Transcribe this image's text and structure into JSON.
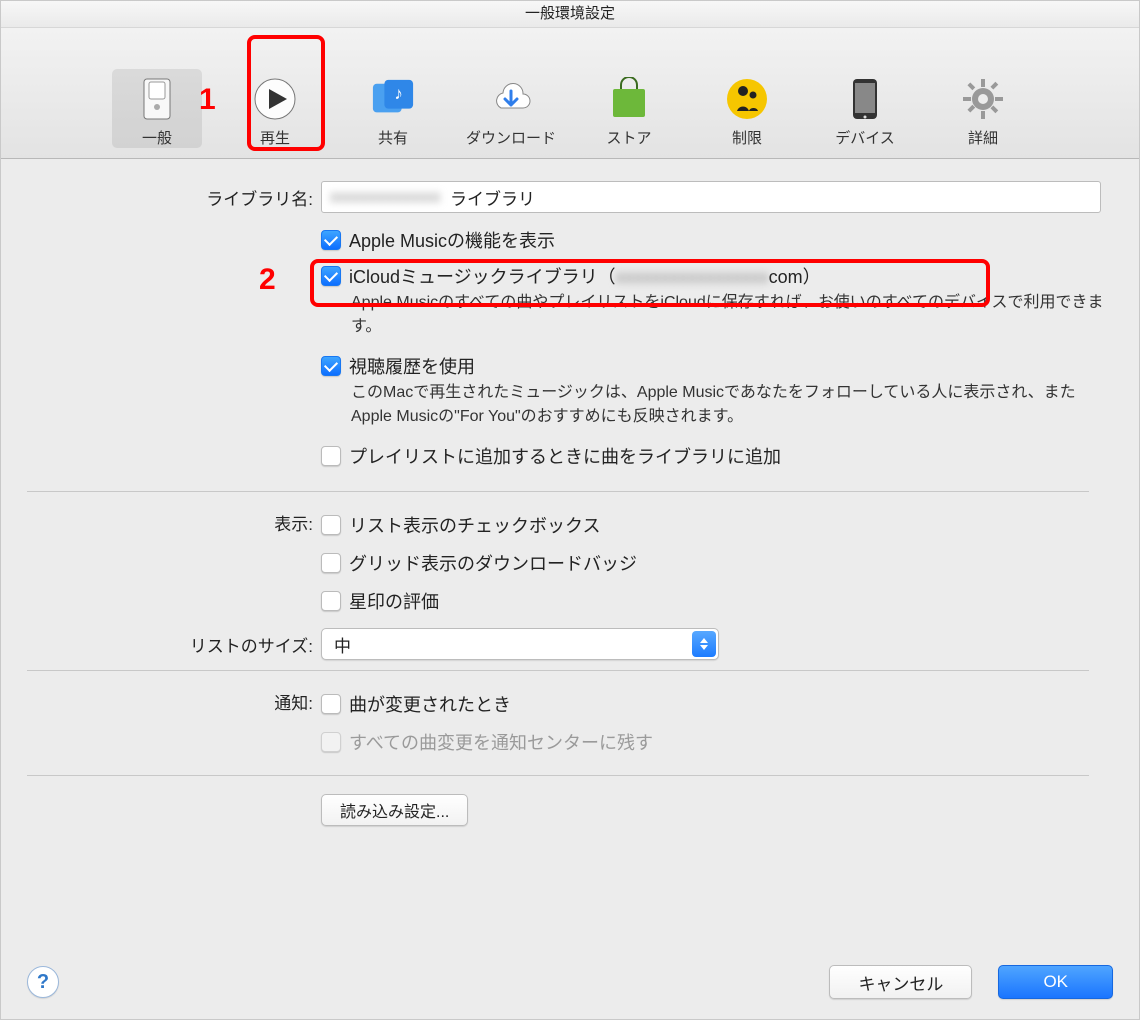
{
  "title": "一般環境設定",
  "annotations": {
    "one": "1",
    "two": "2"
  },
  "toolbar": [
    {
      "label": "一般",
      "icon": "switch",
      "selected": true
    },
    {
      "label": "再生",
      "icon": "play"
    },
    {
      "label": "共有",
      "icon": "share"
    },
    {
      "label": "ダウンロード",
      "icon": "download"
    },
    {
      "label": "ストア",
      "icon": "store"
    },
    {
      "label": "制限",
      "icon": "parental"
    },
    {
      "label": "デバイス",
      "icon": "device"
    },
    {
      "label": "詳細",
      "icon": "gear"
    }
  ],
  "labels": {
    "library_name": "ライブラリ名:",
    "display": "表示:",
    "list_size": "リストのサイズ:",
    "notifications": "通知:"
  },
  "library_field_suffix": "ライブラリ",
  "checks": {
    "apple_music": {
      "checked": true,
      "label": "Apple Musicの機能を表示"
    },
    "icloud": {
      "checked": true,
      "label_pre": "iCloudミュージックライブラリ（",
      "label_post": "com）",
      "desc": "Apple Musicのすべての曲やプレイリストをiCloudに保存すれば、お使いのすべてのデバイスで利用できます。"
    },
    "history": {
      "checked": true,
      "label": "視聴履歴を使用",
      "desc": "このMacで再生されたミュージックは、Apple Musicであなたをフォローしている人に表示され、またApple Musicの\"For You\"のおすすめにも反映されます。"
    },
    "add_playlist": {
      "checked": false,
      "label": "プレイリストに追加するときに曲をライブラリに追加"
    },
    "list_checkbox": {
      "checked": false,
      "label": "リスト表示のチェックボックス"
    },
    "grid_badge": {
      "checked": false,
      "label": "グリッド表示のダウンロードバッジ"
    },
    "star_rating": {
      "checked": false,
      "label": "星印の評価"
    },
    "song_changed": {
      "checked": false,
      "label": "曲が変更されたとき"
    },
    "notif_center": {
      "checked": false,
      "disabled": true,
      "label": "すべての曲変更を通知センターに残す"
    }
  },
  "list_size_value": "中",
  "import_settings_btn": "読み込み設定...",
  "footer": {
    "cancel": "キャンセル",
    "ok": "OK"
  }
}
